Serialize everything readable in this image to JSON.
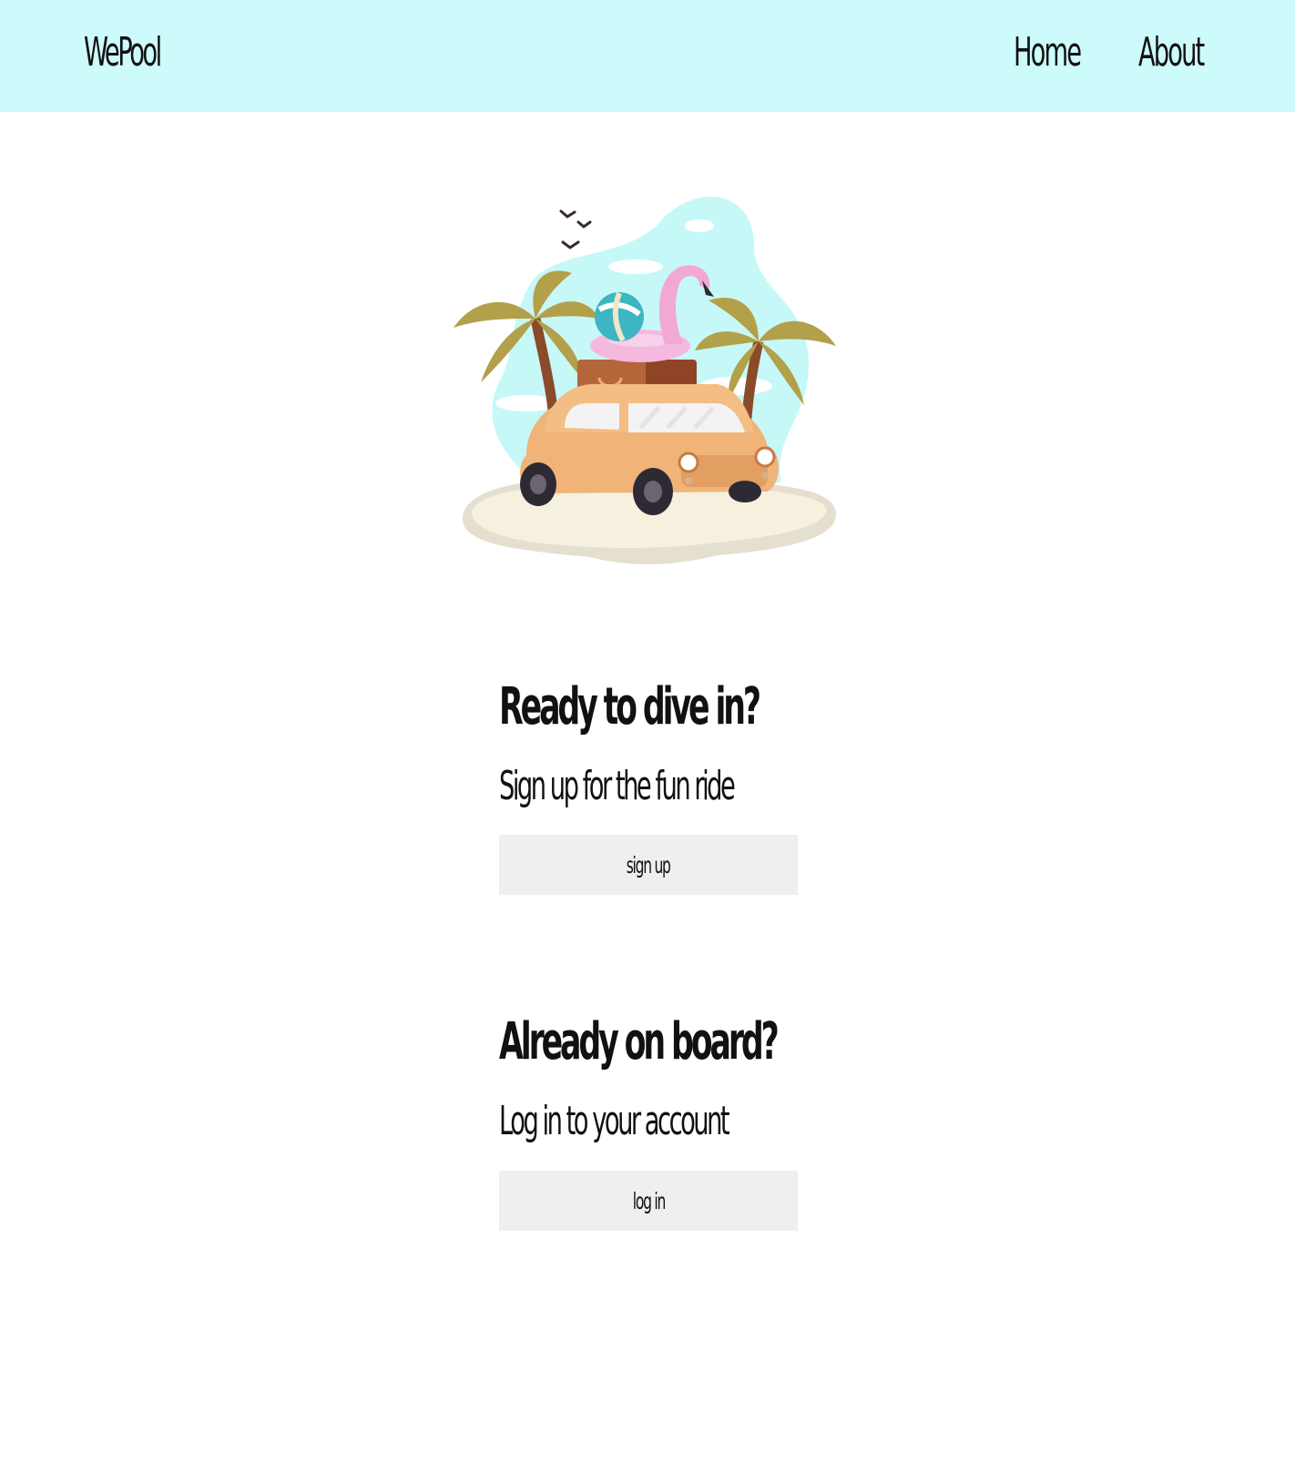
{
  "navbar": {
    "brand": "WePool",
    "links": [
      "Home",
      "About"
    ]
  },
  "colors": {
    "navbar_bg": "#cdfafa",
    "button_bg": "#efefef",
    "text": "#111111"
  },
  "signup_section": {
    "heading": "Ready to dive in?",
    "subheading": "Sign up for the fun ride",
    "button_label": "sign up"
  },
  "login_section": {
    "heading": "Already on board?",
    "subheading": "Log in to your account",
    "button_label": "log in"
  }
}
